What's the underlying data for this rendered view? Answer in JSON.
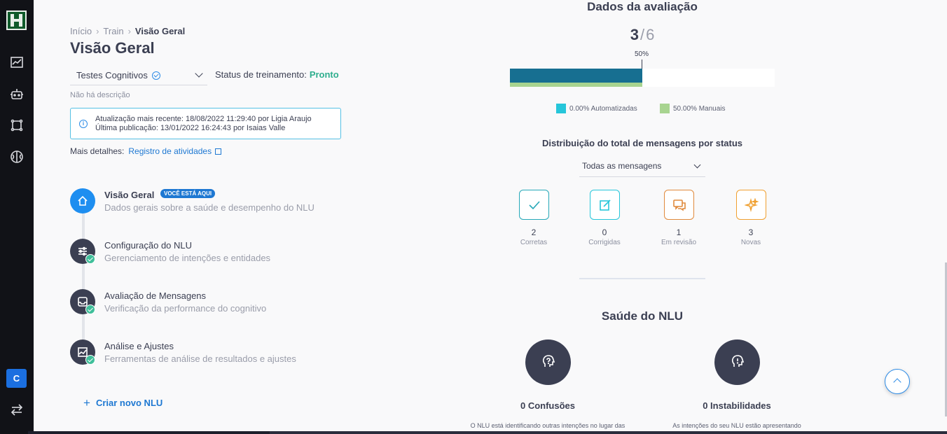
{
  "sidebar": {
    "avatar_letter": "C",
    "icons": [
      "chart-icon",
      "robot-icon",
      "nodes-icon",
      "brain-icon",
      "swap-icon"
    ]
  },
  "breadcrumb": {
    "home": "Início",
    "train": "Train",
    "current": "Visão Geral"
  },
  "page_title": "Visão Geral",
  "selector": {
    "value": "Testes Cognitivos"
  },
  "status": {
    "label": "Status de treinamento:",
    "value": "Pronto"
  },
  "no_description": "Não há descrição",
  "info": {
    "line1_prefix": "Atualização mais recente:",
    "line1_date": "18/08/2022 11:29:40",
    "line1_by": "por",
    "line1_user": "Ligia Araujo",
    "line2_prefix": "Última publicação:",
    "line2_date": "13/01/2022 16:24:43",
    "line2_by": "por",
    "line2_user": "Isaias Valle"
  },
  "details": {
    "label": "Mais detalhes:",
    "link": "Registro de atividades"
  },
  "steps": [
    {
      "title": "Visão Geral",
      "desc": "Dados gerais sobre a saúde e desempenho do NLU",
      "badge": "VOCÊ ESTÁ AQUI"
    },
    {
      "title": "Configuração do NLU",
      "desc": "Gerenciamento de intenções e entidades"
    },
    {
      "title": "Avaliação de Mensagens",
      "desc": "Verificação da performance do cognitivo"
    },
    {
      "title": "Análise e Ajustes",
      "desc": "Ferramentas de análise de resultados e ajustes"
    }
  ],
  "create_label": "Criar novo NLU",
  "evaluation": {
    "title": "Dados da avaliação",
    "done": "3",
    "total": "6",
    "percent_label": "50%",
    "progress_fraction": 0.5,
    "automated_fraction": 0.0,
    "manual_fraction": 0.5,
    "legend_automated": "0.00% Automatizadas",
    "legend_manual": "50.00% Manuais",
    "color_automated": "#26c6da",
    "color_manual": "#a8d490",
    "color_bar": "#176f91"
  },
  "distribution": {
    "title": "Distribuição do total de mensagens por status",
    "filter": "Todas as mensagens",
    "stats": [
      {
        "value": "2",
        "label": "Corretas",
        "icon": "check-icon",
        "color": "#26a8b8"
      },
      {
        "value": "0",
        "label": "Corrigidas",
        "icon": "edit-icon",
        "color": "#26c6da"
      },
      {
        "value": "1",
        "label": "Em revisão",
        "icon": "chat-icon",
        "color": "#e08a3c"
      },
      {
        "value": "3",
        "label": "Novas",
        "icon": "sparkle-icon",
        "color": "#f0a030"
      }
    ]
  },
  "health": {
    "title": "Saúde do NLU",
    "confusions": "0 Confusões",
    "confusions_desc": "O NLU está identificando outras intenções no lugar das",
    "instabilities": "0 Instabilidades",
    "instabilities_desc": "As intenções do seu NLU estão apresentando"
  }
}
